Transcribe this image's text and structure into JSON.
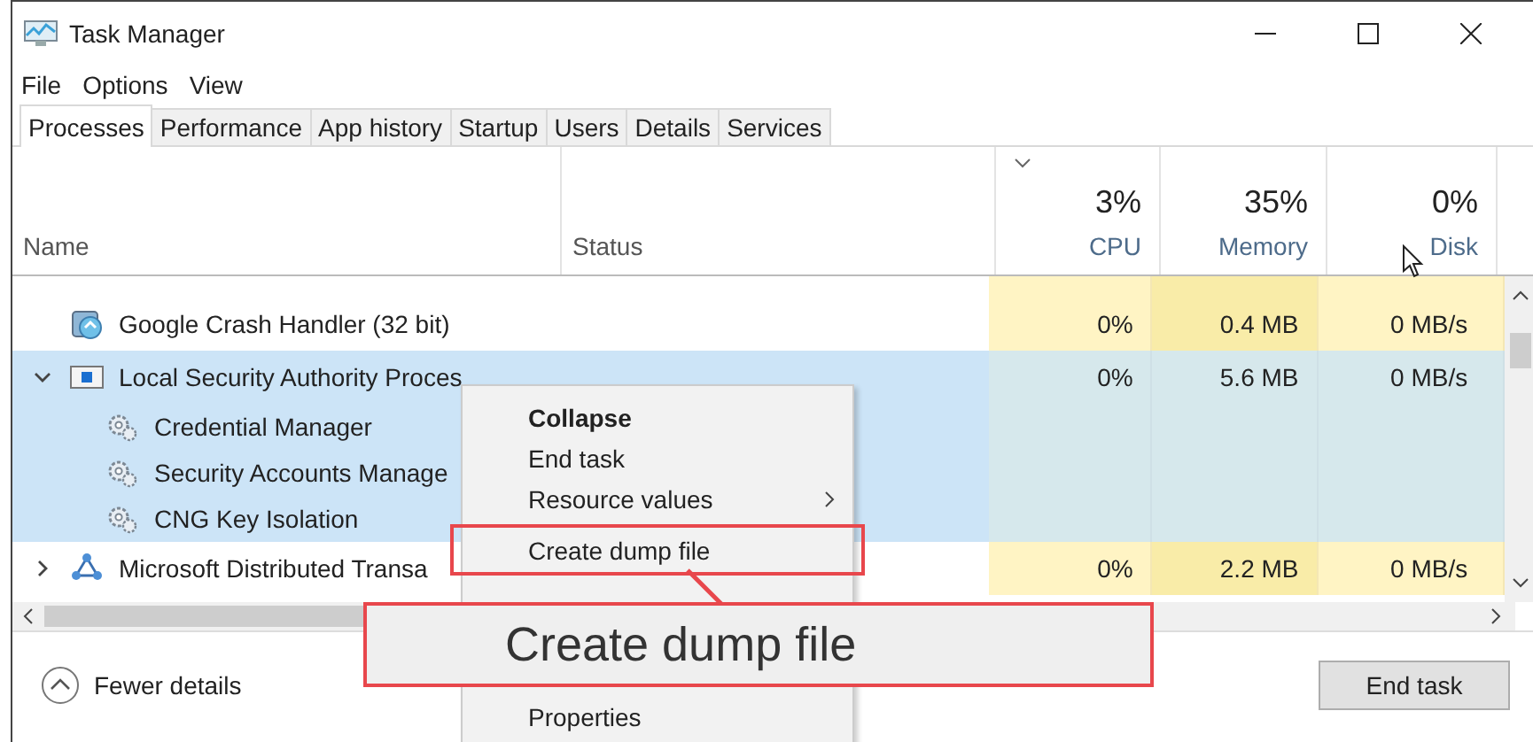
{
  "window": {
    "title": "Task Manager"
  },
  "menu": [
    "File",
    "Options",
    "View"
  ],
  "tabs": [
    {
      "label": "Processes",
      "selected": true
    },
    {
      "label": "Performance",
      "selected": false
    },
    {
      "label": "App history",
      "selected": false
    },
    {
      "label": "Startup",
      "selected": false
    },
    {
      "label": "Users",
      "selected": false
    },
    {
      "label": "Details",
      "selected": false
    },
    {
      "label": "Services",
      "selected": false
    }
  ],
  "columns": [
    {
      "label": "Name",
      "sorted": false
    },
    {
      "label": "Status",
      "sorted": false
    },
    {
      "label": "CPU",
      "usage": "3%",
      "sorted": true
    },
    {
      "label": "Memory",
      "usage": "35%",
      "sorted": false
    },
    {
      "label": "Disk",
      "usage": "0%",
      "sorted": false
    }
  ],
  "rows": [
    {
      "name": "Google Crash Handler (32 bit)",
      "kind": "app",
      "selected": false,
      "cpu": "0%",
      "memory": "0.4 MB",
      "disk": "0 MB/s"
    },
    {
      "name": "Local Security Authority Proces",
      "kind": "group",
      "expanded": true,
      "selected": true,
      "cpu": "0%",
      "memory": "5.6 MB",
      "disk": "0 MB/s",
      "children": [
        {
          "name": "Credential Manager"
        },
        {
          "name": "Security Accounts Manage"
        },
        {
          "name": "CNG Key Isolation"
        }
      ]
    },
    {
      "name": "Microsoft Distributed Transa",
      "kind": "group",
      "expanded": false,
      "selected": false,
      "cpu": "0%",
      "memory": "2.2 MB",
      "disk": "0 MB/s"
    }
  ],
  "context_menu": [
    {
      "label": "Collapse",
      "default": true,
      "submenu": false,
      "highlighted": false
    },
    {
      "label": "End task",
      "default": false,
      "submenu": false,
      "highlighted": false
    },
    {
      "label": "Resource values",
      "default": false,
      "submenu": true,
      "highlighted": false
    },
    {
      "label": "Create dump file",
      "default": false,
      "submenu": false,
      "highlighted": true
    },
    {
      "label": "Properties",
      "default": false,
      "submenu": false,
      "highlighted": false
    }
  ],
  "callout": {
    "text": "Create dump file"
  },
  "footer": {
    "fewer_details": "Fewer details",
    "end_task": "End task"
  }
}
